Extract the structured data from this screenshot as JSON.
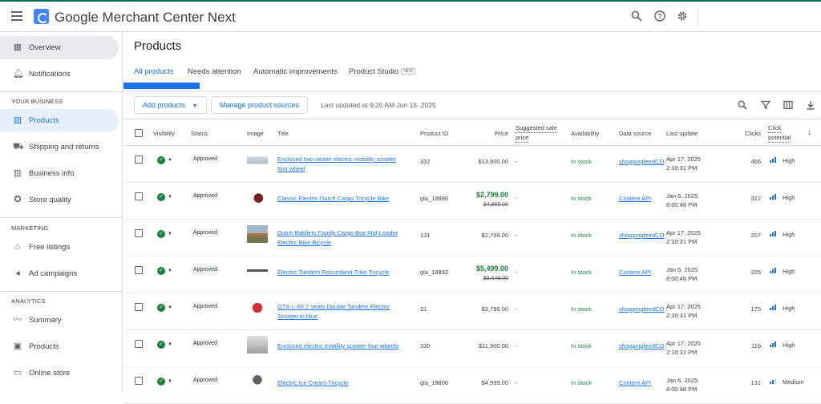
{
  "app": {
    "title": "Google Merchant Center Next"
  },
  "sidebar": {
    "overview": "Overview",
    "notifications": "Notifications",
    "section_business": "YOUR BUSINESS",
    "products": "Products",
    "shipping": "Shipping and returns",
    "business_info": "Business info",
    "store_quality": "Store quality",
    "section_marketing": "MARKETING",
    "free_listings": "Free listings",
    "ad_campaigns": "Ad campaigns",
    "section_analytics": "ANALYTICS",
    "summary": "Summary",
    "an_products": "Products",
    "online_store": "Online store"
  },
  "page": {
    "title": "Products"
  },
  "tabs": [
    {
      "label": "All products"
    },
    {
      "label": "Needs attention"
    },
    {
      "label": "Automatic improvements"
    },
    {
      "label": "Product Studio",
      "badge": "NEW"
    }
  ],
  "toolbar": {
    "add_products": "Add products",
    "manage_sources": "Manage product sources",
    "last_updated": "Last updated at 9:20 AM Jun 15, 2025"
  },
  "table": {
    "headers": {
      "visibility": "Visibility",
      "status": "Status",
      "image": "Image",
      "title": "Title",
      "product_id": "Product ID",
      "price": "Price",
      "suggested_1": "Suggested sale",
      "suggested_2": "price",
      "availability": "Availability",
      "data_source": "Data source",
      "last_update": "Last update",
      "clicks": "Clicks",
      "click_potential_1": "Click",
      "click_potential_2": "potential"
    },
    "rows": [
      {
        "status": "Approved",
        "title_1": "Enclosed two-seater electric mobility scooter",
        "title_2": "four wheel",
        "product_id": "332",
        "price": "$13,900.00",
        "old_price": "",
        "suggested": "-",
        "availability": "In stock",
        "source": "shoppingfeedCO",
        "update_1": "Apr 17, 2025",
        "update_2": "2:10:31 PM",
        "clicks": "466",
        "potential": "High",
        "potential_level": 3
      },
      {
        "status": "Approved",
        "title_1": "Classic Electric Dutch Cargo Tricycle Bike",
        "title_2": "",
        "product_id": "gla_18886",
        "price": "$2,799.00",
        "old_price": "$4,965.00",
        "suggested": "-",
        "availability": "In stock",
        "source": "Content API",
        "update_1": "Jan 6, 2025",
        "update_2": "8:00:48 PM",
        "clicks": "322",
        "potential": "High",
        "potential_level": 3
      },
      {
        "status": "Approved",
        "title_1": "Dutch Bakfiets Family Cargo Box Mid-Loader",
        "title_2": "Electric Bike Bicycle",
        "product_id": "131",
        "price": "$2,799.00",
        "old_price": "",
        "suggested": "-",
        "availability": "In stock",
        "source": "shoppingfeedCO",
        "update_1": "Apr 17, 2025",
        "update_2": "2:10:31 PM",
        "clicks": "207",
        "potential": "High",
        "potential_level": 3
      },
      {
        "status": "Approved",
        "title_1": "Electric Tandem Recumbent Trike Tricycle",
        "title_2": "",
        "product_id": "gla_18892",
        "price": "$5,499.00",
        "old_price": "$9,649.00",
        "suggested": "-",
        "availability": "In stock",
        "source": "Content API",
        "update_1": "Jan 6, 2025",
        "update_2": "8:00:48 PM",
        "clicks": "205",
        "potential": "High",
        "potential_level": 3
      },
      {
        "status": "Approved",
        "title_1": "GTX-L-60 2 seats Double Tandem Electric",
        "title_2": "Scooter in blue",
        "product_id": "31",
        "price": "$3,799.00",
        "old_price": "",
        "suggested": "-",
        "availability": "In stock",
        "source": "shoppingfeedCO",
        "update_1": "Apr 17, 2025",
        "update_2": "2:10:31 PM",
        "clicks": "175",
        "potential": "High",
        "potential_level": 3
      },
      {
        "status": "Approved",
        "title_1": "Enclosed electric mobility scooter four wheels",
        "title_2": "",
        "product_id": "330",
        "price": "$11,900.00",
        "old_price": "",
        "suggested": "-",
        "availability": "In stock",
        "source": "shoppingfeedCO",
        "update_1": "Apr 17, 2025",
        "update_2": "2:10:31 PM",
        "clicks": "116",
        "potential": "High",
        "potential_level": 3
      },
      {
        "status": "Approved",
        "title_1": "Electric Ice Cream Tricycle",
        "title_2": "",
        "product_id": "gla_18806",
        "price": "$4,999.00",
        "old_price": "",
        "suggested": "-",
        "availability": "In stock",
        "source": "Content API",
        "update_1": "Jan 6, 2025",
        "update_2": "8:00:48 PM",
        "clicks": "131",
        "potential": "Medium",
        "potential_level": 2
      }
    ]
  },
  "colors": {
    "accent": "#1a73e8",
    "success": "#188038",
    "topbar_border": "#0b6b53"
  },
  "icons": [
    "menu-icon",
    "merchant-logo-icon",
    "search-icon",
    "help-icon",
    "settings-icon",
    "filter-icon",
    "columns-icon",
    "download-icon",
    "sort-arrow-icon"
  ]
}
